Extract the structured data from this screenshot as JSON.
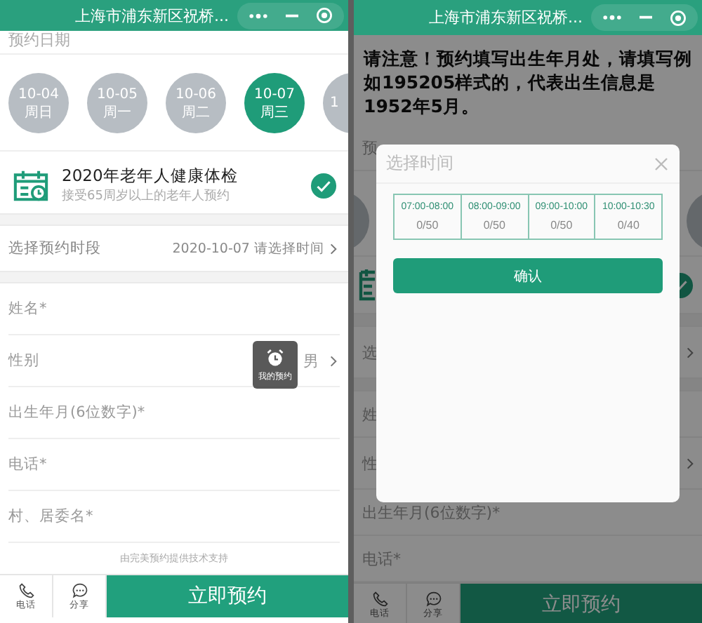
{
  "left_screen": {
    "header": {
      "title": "上海市浦东新区祝桥..."
    },
    "date_label": "预约日期",
    "dates": [
      {
        "date": "10-04",
        "weekday": "周日",
        "selected": false,
        "kind": "full"
      },
      {
        "date": "10-05",
        "weekday": "周一",
        "selected": false,
        "kind": "full"
      },
      {
        "date": "10-06",
        "weekday": "周二",
        "selected": false,
        "kind": "full"
      },
      {
        "date": "10-07",
        "weekday": "周三",
        "selected": true,
        "kind": "full"
      },
      {
        "date": "1",
        "selected": false,
        "kind": "partial"
      }
    ],
    "service": {
      "title": "2020年老年人健康体检",
      "subtitle": "接受65周岁以上的老年人预约",
      "checked": true
    },
    "time_slot": {
      "label": "选择预约时段",
      "value": "2020-10-07 请选择时间"
    },
    "fields": [
      {
        "label": "姓名*",
        "kind": "text"
      },
      {
        "label": "性别",
        "kind": "select",
        "value": "男"
      },
      {
        "label": "出生年月(6位数字)*",
        "kind": "text"
      },
      {
        "label": "电话*",
        "kind": "text"
      },
      {
        "label": "村、居委名*",
        "kind": "text"
      }
    ],
    "floating_button": {
      "label": "我的预约"
    },
    "footer_note": "由完美预约提供技术支持",
    "bottom_bar": {
      "phone_label": "电话",
      "share_label": "分享",
      "submit_label": "立即预约"
    }
  },
  "right_screen": {
    "header": {
      "title": "上海市浦东新区祝桥..."
    },
    "notice": "请注意！预约填写出生年月处，请填写例如195205样式的，代表出生信息是1952年5月。",
    "background_rows": [
      {
        "kind": "label",
        "text": "预"
      },
      {
        "kind": "dates"
      },
      {
        "kind": "service",
        "checked": true
      },
      {
        "kind": "band"
      },
      {
        "kind": "select",
        "text": "选"
      },
      {
        "kind": "band"
      },
      {
        "kind": "label",
        "text": "姓"
      },
      {
        "kind": "select",
        "text": "性"
      },
      {
        "kind": "label",
        "text": "出生年月(6位数字)*"
      },
      {
        "kind": "label",
        "text": "电话*"
      }
    ],
    "bottom_bar": {
      "phone_label": "电话",
      "share_label": "分享",
      "submit_label": "立即预约"
    },
    "modal": {
      "title": "选择时间",
      "slots": [
        {
          "time": "07:00-08:00",
          "count": "0/50"
        },
        {
          "time": "08:00-09:00",
          "count": "0/50"
        },
        {
          "time": "09:00-10:00",
          "count": "0/50"
        },
        {
          "time": "10:00-10:30",
          "count": "0/40"
        }
      ],
      "confirm_label": "确认"
    }
  }
}
